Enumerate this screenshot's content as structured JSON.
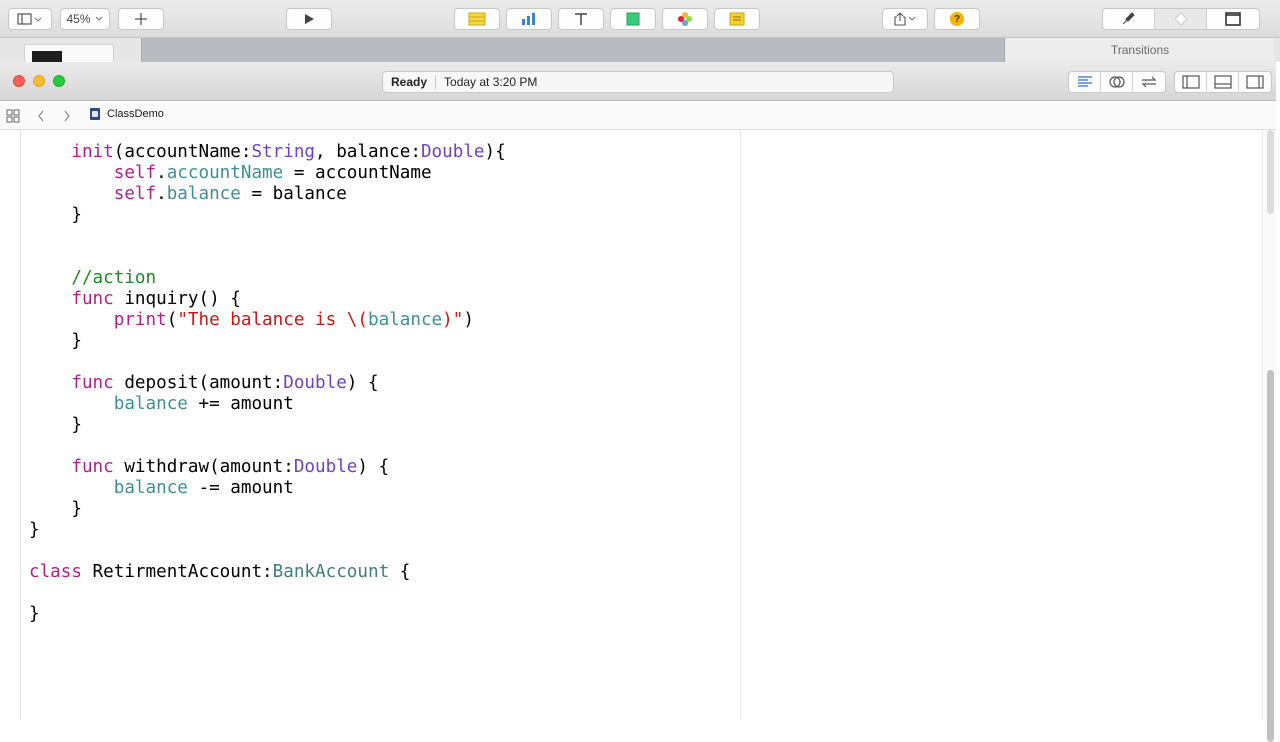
{
  "toolbar": {
    "zoom": "45%",
    "add_label": "+",
    "help_label": "?"
  },
  "strip": {
    "transitions_label": "Transitions"
  },
  "window": {
    "status": "Ready",
    "time": "Today at 3:20 PM"
  },
  "jumpbar": {
    "file": "ClassDemo"
  },
  "code": [
    [
      [
        "fn",
        "    "
      ],
      [
        "kw",
        "init"
      ],
      [
        "fn",
        "(accountName:"
      ],
      [
        "ty",
        "String"
      ],
      [
        "fn",
        ", balance:"
      ],
      [
        "ty",
        "Double"
      ],
      [
        "fn",
        "){"
      ]
    ],
    [
      [
        "fn",
        "        "
      ],
      [
        "kw",
        "self"
      ],
      [
        "fn",
        "."
      ],
      [
        "prop",
        "accountName"
      ],
      [
        "fn",
        " = accountName"
      ]
    ],
    [
      [
        "fn",
        "        "
      ],
      [
        "kw",
        "self"
      ],
      [
        "fn",
        "."
      ],
      [
        "prop",
        "balance"
      ],
      [
        "fn",
        " = balance"
      ]
    ],
    [
      [
        "fn",
        "    }"
      ]
    ],
    [
      [
        "fn",
        ""
      ]
    ],
    [
      [
        "fn",
        ""
      ]
    ],
    [
      [
        "fn",
        "    "
      ],
      [
        "cm",
        "//action"
      ]
    ],
    [
      [
        "fn",
        "    "
      ],
      [
        "kw",
        "func"
      ],
      [
        "fn",
        " inquiry() {"
      ]
    ],
    [
      [
        "fn",
        "        "
      ],
      [
        "kw",
        "print"
      ],
      [
        "fn",
        "("
      ],
      [
        "str",
        "\"The balance is \\("
      ],
      [
        "prop",
        "balance"
      ],
      [
        "str",
        ")\""
      ],
      [
        "fn",
        ")"
      ]
    ],
    [
      [
        "fn",
        "    }"
      ]
    ],
    [
      [
        "fn",
        ""
      ]
    ],
    [
      [
        "fn",
        "    "
      ],
      [
        "kw",
        "func"
      ],
      [
        "fn",
        " deposit(amount:"
      ],
      [
        "ty",
        "Double"
      ],
      [
        "fn",
        ") {"
      ]
    ],
    [
      [
        "fn",
        "        "
      ],
      [
        "prop",
        "balance"
      ],
      [
        "fn",
        " += amount"
      ]
    ],
    [
      [
        "fn",
        "    }"
      ]
    ],
    [
      [
        "fn",
        ""
      ]
    ],
    [
      [
        "fn",
        "    "
      ],
      [
        "kw",
        "func"
      ],
      [
        "fn",
        " withdraw(amount:"
      ],
      [
        "ty",
        "Double"
      ],
      [
        "fn",
        ") {"
      ]
    ],
    [
      [
        "fn",
        "        "
      ],
      [
        "prop",
        "balance"
      ],
      [
        "fn",
        " -= amount"
      ]
    ],
    [
      [
        "fn",
        "    }"
      ]
    ],
    [
      [
        "fn",
        "}"
      ]
    ],
    [
      [
        "fn",
        ""
      ]
    ],
    [
      [
        "kw",
        "class"
      ],
      [
        "fn",
        " RetirmentAccount:"
      ],
      [
        "tyc",
        "BankAccount"
      ],
      [
        "fn",
        " {"
      ]
    ],
    [
      [
        "fn",
        ""
      ]
    ],
    [
      [
        "fn",
        "}"
      ]
    ]
  ],
  "colors": {
    "keyword": "#b21e8c",
    "type": "#6f42c1",
    "property": "#3e8e96",
    "string": "#c41a16",
    "comment": "#1f8a1f"
  }
}
